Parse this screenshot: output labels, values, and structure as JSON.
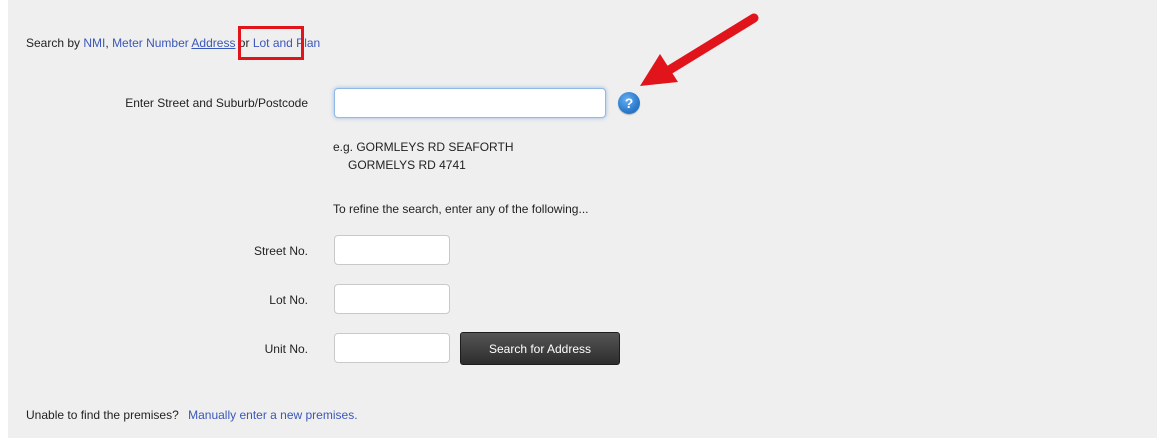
{
  "search_by": {
    "prefix": "Search by",
    "links": [
      "NMI",
      "Meter Number",
      "Address",
      "Lot and Plan"
    ],
    "separator": ",",
    "or_text": "or"
  },
  "street_field": {
    "label": "Enter Street and Suburb/Postcode",
    "value": "",
    "help_icon": "?"
  },
  "example": {
    "line1": "e.g. GORMLEYS RD SEAFORTH",
    "line2": "GORMELYS RD 4741"
  },
  "refine_text": "To refine the search, enter any of the following...",
  "fields": [
    {
      "label": "Street No.",
      "value": ""
    },
    {
      "label": "Lot No.",
      "value": ""
    },
    {
      "label": "Unit No.",
      "value": ""
    }
  ],
  "search_button": "Search for Address",
  "footer": {
    "question": "Unable to find the premises?",
    "link": "Manually enter a new premises."
  },
  "colors": {
    "link": "#3b57b8",
    "annotation": "#e1141c",
    "panel_bg": "#efefef"
  }
}
